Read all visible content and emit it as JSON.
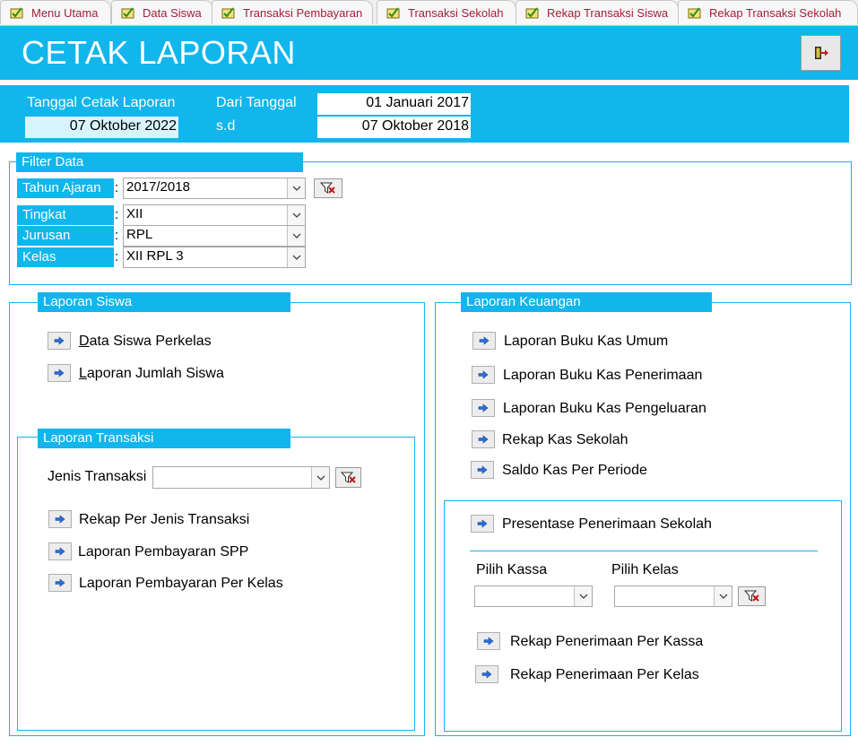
{
  "tabs": [
    {
      "label": "Menu Utama"
    },
    {
      "label": "Data Siswa"
    },
    {
      "label": "Transaksi Pembayaran"
    },
    {
      "label": "Transaksi Sekolah"
    },
    {
      "label": "Rekap Transaksi Siswa"
    },
    {
      "label": "Rekap Transaksi Sekolah"
    }
  ],
  "header": {
    "title": "CETAK LAPORAN"
  },
  "dates": {
    "tanggal_cetak_label": "Tanggal Cetak Laporan",
    "tanggal_cetak_value": "07 Oktober 2022",
    "dari_tanggal_label": "Dari Tanggal",
    "dari_tanggal_value": "01 Januari 2017",
    "sd_label": "s.d",
    "sd_value": "07 Oktober 2018"
  },
  "filter": {
    "title": "Filter Data",
    "colon": ":",
    "tahun_ajaran_label": "Tahun Ajaran",
    "tahun_ajaran_value": "2017/2018",
    "tingkat_label": "Tingkat",
    "tingkat_value": "XII",
    "jurusan_label": "Jurusan",
    "jurusan_value": "RPL",
    "kelas_label": "Kelas",
    "kelas_value": "XII RPL 3"
  },
  "laporan_siswa": {
    "title": "Laporan Siswa",
    "items": [
      {
        "first": "D",
        "rest": "ata Siswa Perkelas"
      },
      {
        "first": "L",
        "rest": "aporan Jumlah Siswa"
      }
    ]
  },
  "laporan_transaksi": {
    "title": "Laporan Transaksi",
    "jenis_label": "Jenis Transaksi",
    "jenis_value": "",
    "items": [
      {
        "label": "Rekap Per Jenis Transaksi"
      },
      {
        "label": "Laporan Pembayaran SPP"
      },
      {
        "label": "Laporan Pembayaran Per Kelas"
      }
    ]
  },
  "laporan_keuangan": {
    "title": "Laporan Keuangan",
    "items": [
      {
        "label": "Laporan Buku Kas Umum"
      },
      {
        "label": "Laporan Buku Kas Penerimaan"
      },
      {
        "label": "Laporan Buku Kas Pengeluaran"
      },
      {
        "label": "Rekap Kas Sekolah"
      },
      {
        "label": "Saldo Kas Per Periode"
      }
    ],
    "presentase_label": "Presentase Penerimaan Sekolah",
    "pilih_kassa_label": "Pilih Kassa",
    "pilih_kassa_value": "",
    "pilih_kelas_label": "Pilih Kelas",
    "pilih_kelas_value": "",
    "rekap_kassa_label": "Rekap Penerimaan Per Kassa",
    "rekap_kelas_label": "Rekap Penerimaan Per Kelas"
  },
  "colors": {
    "accent": "#11b6ec",
    "tab_text": "#a0213a"
  }
}
